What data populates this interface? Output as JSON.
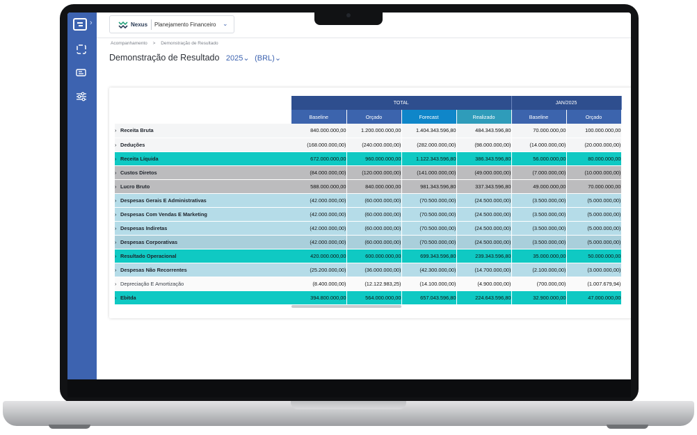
{
  "app": {
    "brand": "Nexus",
    "module": "Planejamento Financeiro"
  },
  "breadcrumb": [
    "Acompanhamento",
    ">",
    "Demonstração de Resultado"
  ],
  "page": {
    "title": "Demonstração de Resultado",
    "year": "2025",
    "currency": "(BRL)"
  },
  "table": {
    "groups": [
      "TOTAL",
      "JAN/2025"
    ],
    "columns": [
      "Baseline",
      "Orçado",
      "Forecast",
      "Realizado",
      "Baseline",
      "Orçado"
    ],
    "rows": [
      {
        "label": "Receita Bruta",
        "style": "white",
        "values": [
          "840.000.000,00",
          "1.200.000.000,00",
          "1.404.343.596,80",
          "484.343.596,80",
          "70.000.000,00",
          "100.000.000,00"
        ]
      },
      {
        "label": "Deduções",
        "style": "white",
        "values": [
          "(168.000.000,00)",
          "(240.000.000,00)",
          "(282.000.000,00)",
          "(98.000.000,00)",
          "(14.000.000,00)",
          "(20.000.000,00)"
        ]
      },
      {
        "label": "Receita Líquida",
        "style": "teal",
        "values": [
          "672.000.000,00",
          "960.000.000,00",
          "1.122.343.596,80",
          "386.343.596,80",
          "56.000.000,00",
          "80.000.000,00"
        ]
      },
      {
        "label": "Custos Diretos",
        "style": "gray",
        "values": [
          "(84.000.000,00)",
          "(120.000.000,00)",
          "(141.000.000,00)",
          "(49.000.000,00)",
          "(7.000.000,00)",
          "(10.000.000,00)"
        ]
      },
      {
        "label": "Lucro Bruto",
        "style": "gray",
        "values": [
          "588.000.000,00",
          "840.000.000,00",
          "981.343.596,80",
          "337.343.596,80",
          "49.000.000,00",
          "70.000.000,00"
        ]
      },
      {
        "label": "Despesas Gerais E Administrativas",
        "style": "blue",
        "values": [
          "(42.000.000,00)",
          "(60.000.000,00)",
          "(70.500.000,00)",
          "(24.500.000,00)",
          "(3.500.000,00)",
          "(5.000.000,00)"
        ]
      },
      {
        "label": "Despesas Com Vendas E Marketing",
        "style": "blue",
        "values": [
          "(42.000.000,00)",
          "(60.000.000,00)",
          "(70.500.000,00)",
          "(24.500.000,00)",
          "(3.500.000,00)",
          "(5.000.000,00)"
        ]
      },
      {
        "label": "Despesas Indiretas",
        "style": "blue",
        "values": [
          "(42.000.000,00)",
          "(60.000.000,00)",
          "(70.500.000,00)",
          "(24.500.000,00)",
          "(3.500.000,00)",
          "(5.000.000,00)"
        ]
      },
      {
        "label": "Despesas Corporativas",
        "style": "blue2",
        "values": [
          "(42.000.000,00)",
          "(60.000.000,00)",
          "(70.500.000,00)",
          "(24.500.000,00)",
          "(3.500.000,00)",
          "(5.000.000,00)"
        ]
      },
      {
        "label": "Resultado Operacional",
        "style": "teal",
        "values": [
          "420.000.000,00",
          "600.000.000,00",
          "699.343.596,80",
          "239.343.596,80",
          "35.000.000,00",
          "50.000.000,00"
        ]
      },
      {
        "label": "Despesas Não Recorrentes",
        "style": "blue",
        "values": [
          "(25.200.000,00)",
          "(36.000.000,00)",
          "(42.300.000,00)",
          "(14.700.000,00)",
          "(2.100.000,00)",
          "(3.000.000,00)"
        ]
      },
      {
        "label": "Depreciação E Amortização",
        "style": "light",
        "values": [
          "(8.400.000,00)",
          "(12.122.983,25)",
          "(14.100.000,00)",
          "(4.900.000,00)",
          "(700.000,00)",
          "(1.007.679,94)"
        ]
      },
      {
        "label": "Ebitda",
        "style": "teal",
        "values": [
          "394.800.000,00",
          "564.000.000,00",
          "657.043.596,80",
          "224.643.596,80",
          "32.900.000,00",
          "47.000.000,00"
        ]
      }
    ]
  },
  "colors": {
    "sidebar": "#3d63b0",
    "teal": "#0fc9c3",
    "header": "#2e4e8e",
    "forecast": "#0f86c9"
  }
}
